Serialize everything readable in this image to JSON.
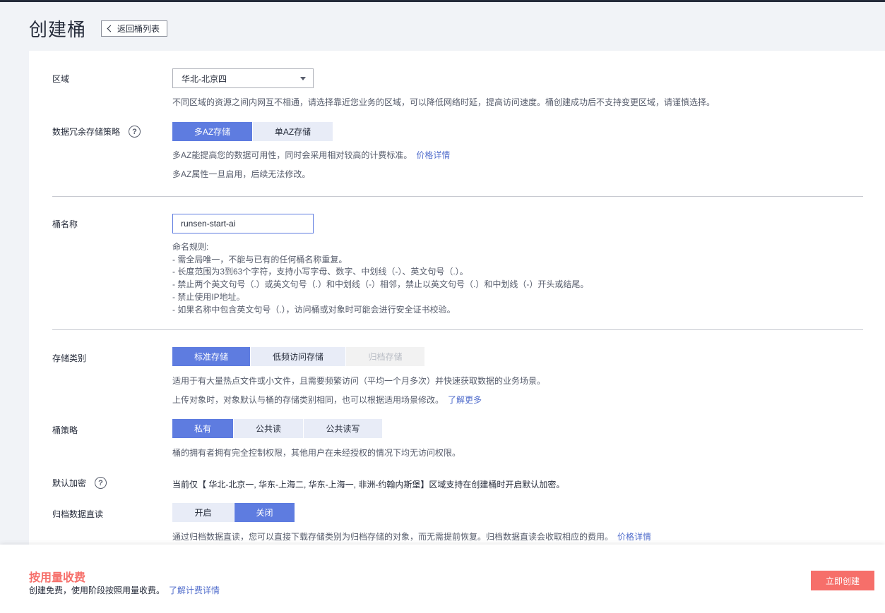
{
  "header": {
    "title": "创建桶",
    "back_label": "返回桶列表"
  },
  "region": {
    "label": "区域",
    "selected": "华北-北京四",
    "desc": "不同区域的资源之间内网互不相通，请选择靠近您业务的区域，可以降低网络时延，提高访问速度。桶创建成功后不支持变更区域，请谨慎选择。"
  },
  "redundancy": {
    "label": "数据冗余存储策略",
    "options": [
      "多AZ存储",
      "单AZ存储"
    ],
    "desc1": "多AZ能提高您的数据可用性，同时会采用相对较高的计费标准。",
    "price_link": "价格详情",
    "desc2": "多AZ属性一旦启用，后续无法修改。"
  },
  "bucket_name": {
    "label": "桶名称",
    "value": "runsen-start-ai",
    "rules": [
      "命名规则:",
      "- 需全局唯一，不能与已有的任何桶名称重复。",
      "- 长度范围为3到63个字符，支持小写字母、数字、中划线（-）、英文句号（.）。",
      "- 禁止两个英文句号（.）或英文句号（.）和中划线（-）相邻，禁止以英文句号（.）和中划线（-）开头或结尾。",
      "- 禁止使用IP地址。",
      "- 如果名称中包含英文句号（.），访问桶或对象时可能会进行安全证书校验。"
    ]
  },
  "storage_class": {
    "label": "存储类别",
    "options": [
      "标准存储",
      "低频访问存储",
      "归档存储"
    ],
    "desc1": "适用于有大量热点文件或小文件，且需要频繁访问（平均一个月多次）并快速获取数据的业务场景。",
    "desc2": "上传对象时，对象默认与桶的存储类别相同，也可以根据适用场景修改。",
    "learn_more": "了解更多"
  },
  "policy": {
    "label": "桶策略",
    "options": [
      "私有",
      "公共读",
      "公共读写"
    ],
    "desc": "桶的拥有者拥有完全控制权限，其他用户在未经授权的情况下均无访问权限。"
  },
  "encryption": {
    "label": "默认加密",
    "text": "当前仅【 华北-北京一, 华东-上海二, 华东-上海一, 非洲-约翰内斯堡】区域支持在创建桶时开启默认加密。"
  },
  "archive_read": {
    "label": "归档数据直读",
    "options": [
      "开启",
      "关闭"
    ],
    "desc": "通过归档数据直读，您可以直接下载存储类别为归档存储的对象，而无需提前恢复。归档数据直读会收取相应的费用。",
    "price_link": "价格详情"
  },
  "footer": {
    "billing_title": "按用量收费",
    "billing_desc": "创建免费，使用阶段按照用量收费。",
    "billing_link": "了解计费详情",
    "create_label": "立即创建"
  },
  "colors": {
    "primary": "#5e7ce0",
    "danger": "#f66f6a",
    "link": "#526ecc"
  }
}
